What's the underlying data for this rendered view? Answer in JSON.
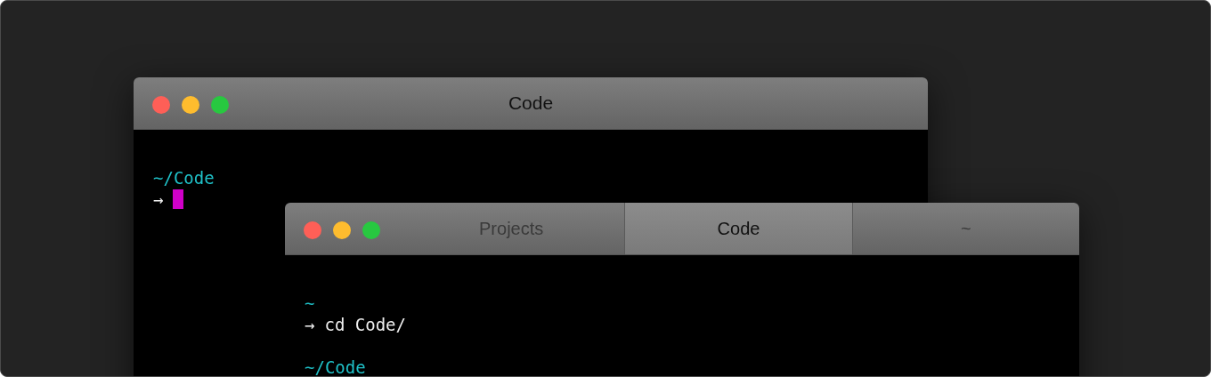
{
  "windows": [
    {
      "kind": "single",
      "title": "Code",
      "lines": [
        {
          "kind": "path",
          "text": "~/Code"
        },
        {
          "kind": "prompt",
          "arrow": "→",
          "cursor": true
        }
      ]
    },
    {
      "kind": "tabbed",
      "tabs": [
        {
          "label": "Projects",
          "selected": false
        },
        {
          "label": "Code",
          "selected": true
        },
        {
          "label": "~",
          "selected": false
        }
      ],
      "lines": [
        {
          "kind": "path",
          "text": "~"
        },
        {
          "kind": "prompt",
          "arrow": "→",
          "text": "cd Code/",
          "cursor": false
        },
        {
          "kind": "blank"
        },
        {
          "kind": "path",
          "text": "~/Code"
        }
      ]
    }
  ]
}
